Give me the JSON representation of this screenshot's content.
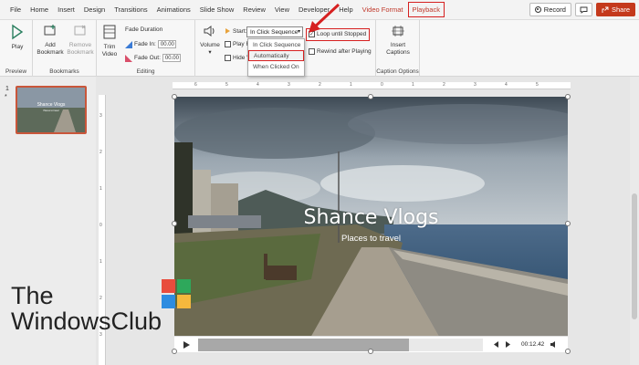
{
  "menu": {
    "tabs": [
      "File",
      "Home",
      "Insert",
      "Design",
      "Transitions",
      "Animations",
      "Slide Show",
      "Review",
      "View",
      "Developer",
      "Help",
      "Video Format",
      "Playback"
    ],
    "record": "Record",
    "share": "Share"
  },
  "ribbon": {
    "preview": {
      "play": "Play",
      "group": "Preview"
    },
    "bookmarks": {
      "add": "Add\nBookmark",
      "remove": "Remove\nBookmark",
      "group": "Bookmarks"
    },
    "editing": {
      "trim": "Trim\nVideo",
      "fade_duration": "Fade Duration",
      "fade_in_label": "Fade In:",
      "fade_in_value": "00.00",
      "fade_out_label": "Fade Out:",
      "fade_out_value": "00.00",
      "group": "Editing"
    },
    "video_options": {
      "volume": "Volume",
      "start_label": "Start:",
      "start_value": "In Click Sequence",
      "play_full": "Play Fu",
      "hide": "Hide V",
      "loop": "Loop until Stopped",
      "rewind": "Rewind after Playing",
      "dropdown_options": [
        "In Click Sequence",
        "Automatically",
        "When Clicked On"
      ],
      "highlighted_option": "Automatically"
    },
    "caption": {
      "insert": "Insert\nCaptions",
      "group": "Caption Options"
    }
  },
  "thumbnails": {
    "number": "1",
    "star": "*",
    "title": "Shance Vlogs",
    "subtitle": "Places to travel"
  },
  "slide": {
    "title": "Shance Vlogs",
    "subtitle": "Places to travel",
    "time": "00:12.42"
  },
  "watermark": {
    "line1": "The",
    "line2": "WindowsClub"
  },
  "colors": {
    "accent": "#c4391c",
    "highlight": "#d62020"
  }
}
